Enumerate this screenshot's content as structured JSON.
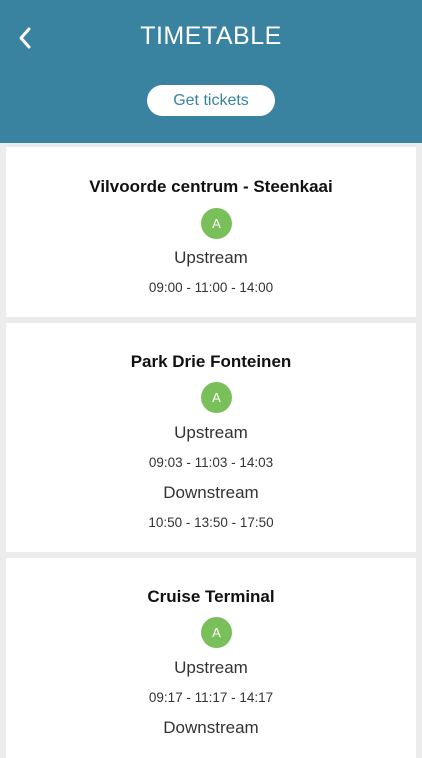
{
  "header": {
    "title": "TIMETABLE",
    "tickets_label": "Get tickets"
  },
  "stops": [
    {
      "name": "Vilvoorde centrum - Steenkaai",
      "line": "A",
      "directions": [
        {
          "label": "Upstream",
          "times": "09:00 - 11:00 - 14:00"
        }
      ]
    },
    {
      "name": "Park Drie Fonteinen",
      "line": "A",
      "directions": [
        {
          "label": "Upstream",
          "times": "09:03 - 11:03 - 14:03"
        },
        {
          "label": "Downstream",
          "times": "10:50 - 13:50 - 17:50"
        }
      ]
    },
    {
      "name": "Cruise Terminal",
      "line": "A",
      "directions": [
        {
          "label": "Upstream",
          "times": "09:17 - 11:17 - 14:17"
        },
        {
          "label": "Downstream",
          "times": ""
        }
      ]
    }
  ],
  "colors": {
    "header_bg": "#3a83a0",
    "badge_bg": "#7ac05a",
    "page_bg": "#ececec"
  }
}
